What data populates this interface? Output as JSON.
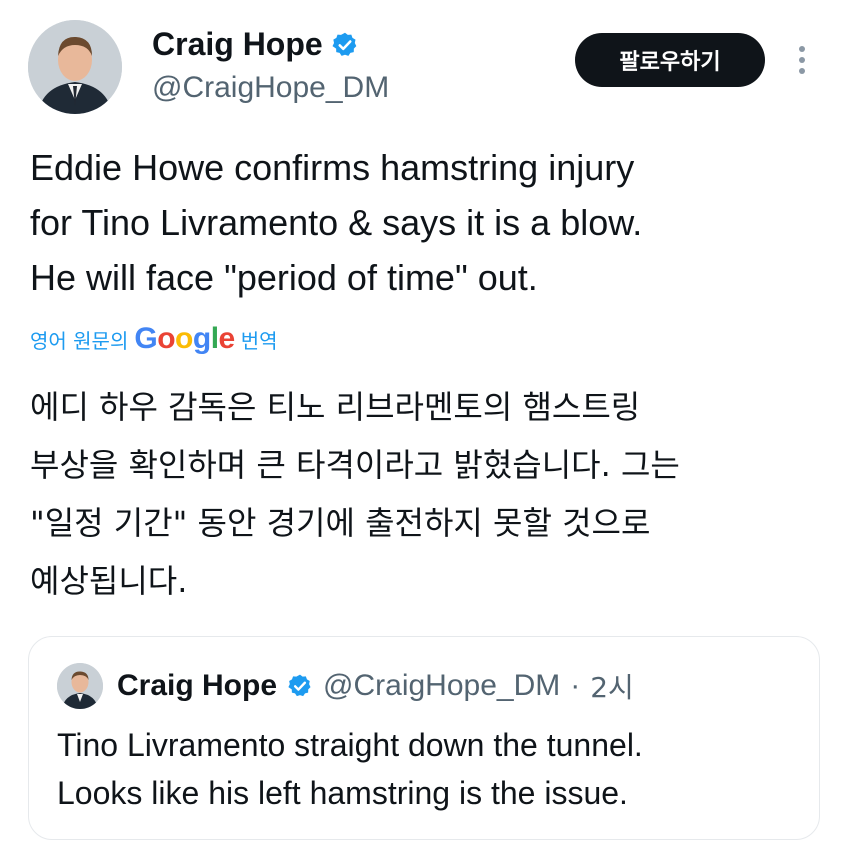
{
  "author": {
    "name": "Craig Hope",
    "handle": "@CraigHope_DM",
    "avatar_icon": "profile-photo",
    "verified_icon": "verified-badge-icon"
  },
  "actions": {
    "follow_label": "팔로우하기",
    "more_icon": "more-vertical-icon"
  },
  "tweet": {
    "text": "Eddie Howe confirms hamstring injury\nfor Tino Livramento & says it is a blow.\nHe will face \"period of time\" out."
  },
  "translation": {
    "prefix": "영어 원문의",
    "provider_letters": [
      "G",
      "o",
      "o",
      "g",
      "l",
      "e"
    ],
    "suffix": "번역",
    "text": "에디 하우 감독은 티노 리브라멘토의 햄스트링\n부상을 확인하며 큰 타격이라고 밝혔습니다. 그는\n\"일정 기간\" 동안 경기에 출전하지 못할 것으로\n예상됩니다."
  },
  "quoted_tweet": {
    "name": "Craig Hope",
    "handle": "@CraigHope_DM",
    "separator": "·",
    "time": "2시",
    "text": "Tino Livramento straight down the tunnel.\nLooks like his left hamstring is the issue."
  },
  "colors": {
    "accent": "#1d9bf0",
    "text": "#0f1419",
    "secondary_text": "#536471",
    "button_bg": "#0f1419",
    "border": "#e6e9ec"
  }
}
